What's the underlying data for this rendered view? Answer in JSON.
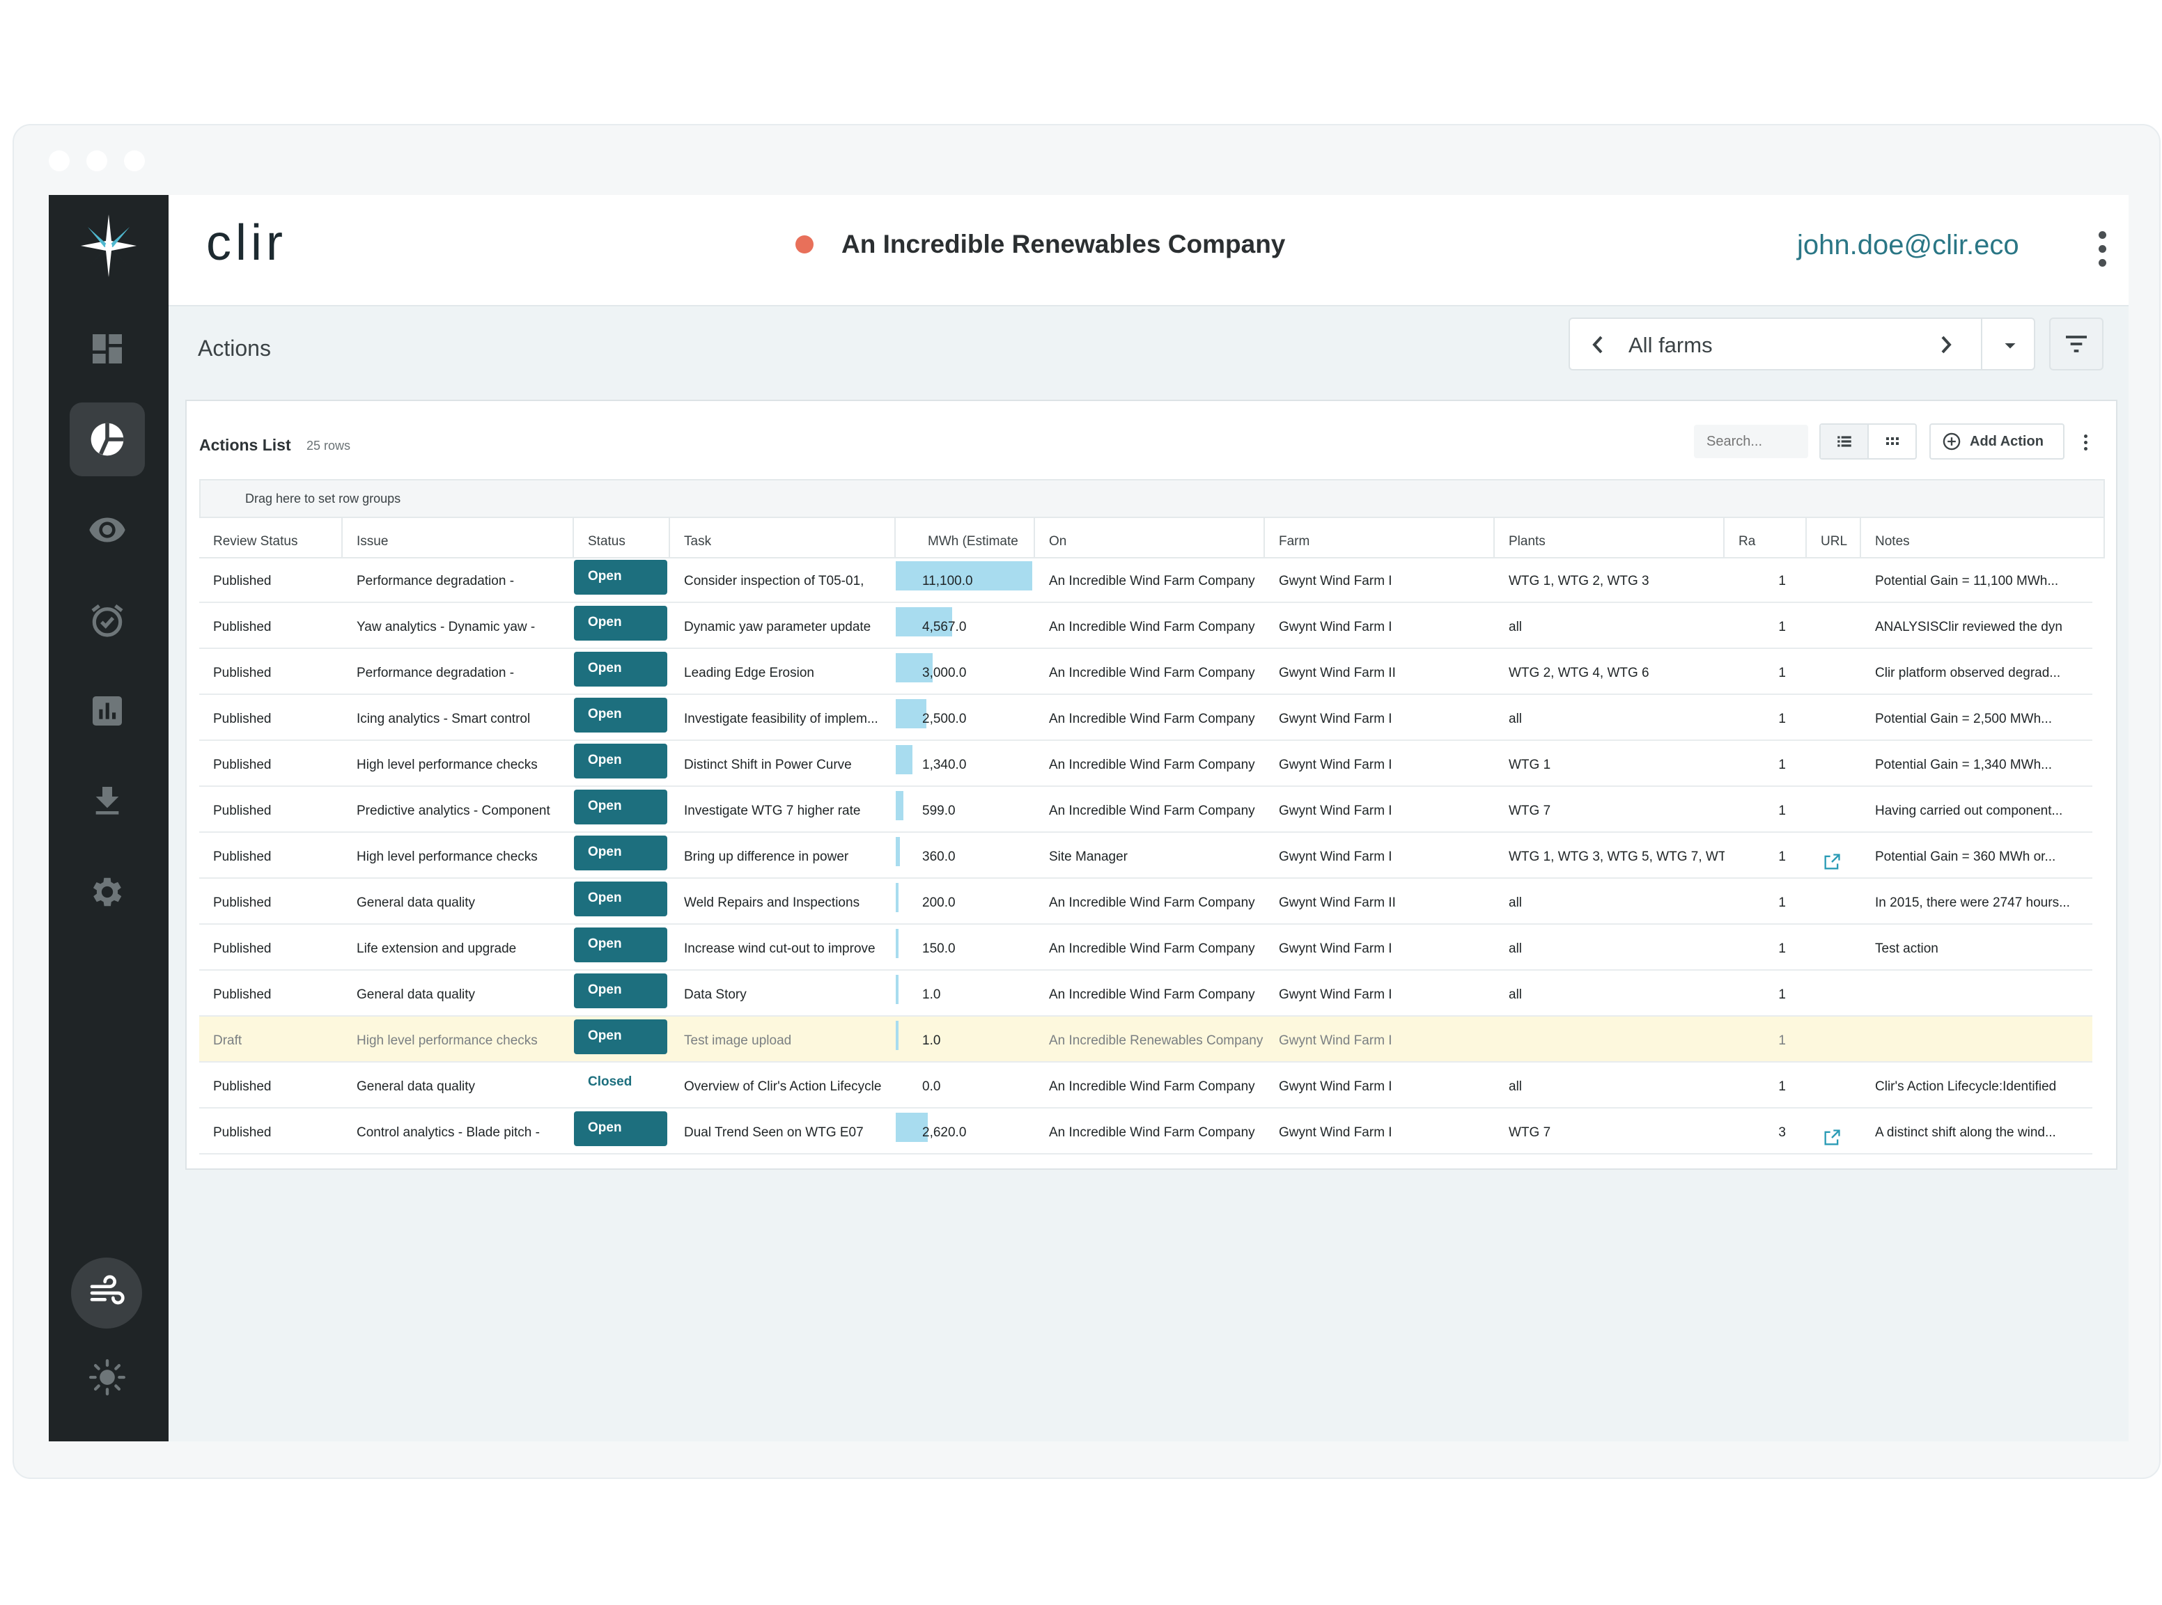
{
  "header": {
    "logo": "clir",
    "company": "An Incredible Renewables Company",
    "user_email": "john.doe@clir.eco"
  },
  "colors": {
    "accent": "#1d6f7e",
    "status_dot": "#e8705a",
    "sidebar": "#1f2426",
    "bar": "#a8dcef",
    "draft_row": "#fdf8dd"
  },
  "sidebar": {
    "items": [
      {
        "icon": "dashboard-icon"
      },
      {
        "icon": "pie-chart-icon",
        "active": true
      },
      {
        "icon": "eye-icon"
      },
      {
        "icon": "alarm-clock-icon"
      },
      {
        "icon": "bar-chart-icon"
      },
      {
        "icon": "download-icon"
      },
      {
        "icon": "gear-icon"
      }
    ],
    "bottom": [
      {
        "icon": "wind-icon"
      },
      {
        "icon": "sun-icon"
      }
    ]
  },
  "page": {
    "title": "Actions",
    "farm_selector": "All farms"
  },
  "card": {
    "title": "Actions List",
    "row_count": "25 rows",
    "search_placeholder": "Search...",
    "add_action": "Add Action",
    "group_zone": "Drag here to set row groups"
  },
  "table": {
    "columns": [
      "Review Status",
      "Issue",
      "Status",
      "Task",
      "MWh (Estimate",
      "On",
      "Farm",
      "Plants",
      "Ra",
      "URL",
      "Notes"
    ],
    "rows": [
      {
        "review": "Published",
        "issue": "Performance degradation -",
        "status": "Open",
        "task": "Consider inspection of T05-01,",
        "mwh": "11,100.0",
        "mwh_value": 11100,
        "on": "An Incredible Wind Farm Company",
        "farm": "Gwynt Wind Farm I",
        "plants": "WTG 1, WTG 2, WTG 3",
        "ra": "1",
        "url": false,
        "notes": "Potential Gain = 11,100 MWh..."
      },
      {
        "review": "Published",
        "issue": "Yaw analytics - Dynamic yaw -",
        "status": "Open",
        "task": "Dynamic yaw parameter update",
        "mwh": "4,567.0",
        "mwh_value": 4567,
        "on": "An Incredible Wind Farm Company",
        "farm": "Gwynt Wind Farm I",
        "plants": "all",
        "ra": "1",
        "url": false,
        "notes": "ANALYSISClir reviewed the dyn"
      },
      {
        "review": "Published",
        "issue": "Performance degradation -",
        "status": "Open",
        "task": "Leading Edge Erosion",
        "mwh": "3,000.0",
        "mwh_value": 3000,
        "on": "An Incredible Wind Farm Company",
        "farm": "Gwynt Wind Farm II",
        "plants": "WTG 2, WTG 4, WTG 6",
        "ra": "1",
        "url": false,
        "notes": "Clir platform observed degrad..."
      },
      {
        "review": "Published",
        "issue": "Icing analytics - Smart control",
        "status": "Open",
        "task": "Investigate feasibility of implem...",
        "mwh": "2,500.0",
        "mwh_value": 2500,
        "on": "An Incredible Wind Farm Company",
        "farm": "Gwynt Wind Farm I",
        "plants": "all",
        "ra": "1",
        "url": false,
        "notes": "Potential Gain = 2,500 MWh..."
      },
      {
        "review": "Published",
        "issue": "High level performance checks",
        "status": "Open",
        "task": "Distinct Shift in Power Curve",
        "mwh": "1,340.0",
        "mwh_value": 1340,
        "on": "An Incredible Wind Farm Company",
        "farm": "Gwynt Wind Farm I",
        "plants": "WTG 1",
        "ra": "1",
        "url": false,
        "notes": "Potential Gain = 1,340 MWh..."
      },
      {
        "review": "Published",
        "issue": "Predictive analytics - Component",
        "status": "Open",
        "task": "Investigate WTG 7 higher rate",
        "mwh": "599.0",
        "mwh_value": 599,
        "on": "An Incredible Wind Farm Company",
        "farm": "Gwynt Wind Farm I",
        "plants": "WTG 7",
        "ra": "1",
        "url": false,
        "notes": "Having carried out component..."
      },
      {
        "review": "Published",
        "issue": "High level performance checks",
        "status": "Open",
        "task": "Bring up difference in power",
        "mwh": "360.0",
        "mwh_value": 360,
        "on": "Site Manager",
        "farm": "Gwynt Wind Farm I",
        "plants": "WTG 1, WTG 3, WTG 5, WTG 7, WTG",
        "ra": "1",
        "url": true,
        "notes": "Potential Gain = 360 MWh or..."
      },
      {
        "review": "Published",
        "issue": "General data quality",
        "status": "Open",
        "task": "Weld Repairs and Inspections",
        "mwh": "200.0",
        "mwh_value": 200,
        "on": "An Incredible Wind Farm Company",
        "farm": "Gwynt Wind Farm II",
        "plants": "all",
        "ra": "1",
        "url": false,
        "notes": "In 2015, there were 2747 hours..."
      },
      {
        "review": "Published",
        "issue": "Life extension and upgrade",
        "status": "Open",
        "task": "Increase wind cut-out to improve",
        "mwh": "150.0",
        "mwh_value": 150,
        "on": "An Incredible Wind Farm Company",
        "farm": "Gwynt Wind Farm I",
        "plants": "all",
        "ra": "1",
        "url": false,
        "notes": "Test action"
      },
      {
        "review": "Published",
        "issue": "General data quality",
        "status": "Open",
        "task": "Data Story",
        "mwh": "1.0",
        "mwh_value": 1,
        "on": "An Incredible Wind Farm Company",
        "farm": "Gwynt Wind Farm I",
        "plants": "all",
        "ra": "1",
        "url": false,
        "notes": ""
      },
      {
        "review": "Draft",
        "issue": "High level performance checks",
        "status": "Open",
        "task": "Test image upload",
        "mwh": "1.0",
        "mwh_value": 1,
        "on": "An Incredible Renewables Company",
        "farm": "Gwynt Wind Farm I",
        "plants": "",
        "ra": "1",
        "url": false,
        "notes": ""
      },
      {
        "review": "Published",
        "issue": "General data quality",
        "status": "Closed",
        "task": "Overview of Clir's Action Lifecycle",
        "mwh": "0.0",
        "mwh_value": 0,
        "on": "An Incredible Wind Farm Company",
        "farm": "Gwynt Wind Farm I",
        "plants": "all",
        "ra": "1",
        "url": false,
        "notes": "Clir's Action Lifecycle:Identified"
      },
      {
        "review": "Published",
        "issue": "Control analytics - Blade pitch -",
        "status": "Open",
        "task": "Dual Trend Seen on WTG E07",
        "mwh": "2,620.0",
        "mwh_value": 2620,
        "on": "An Incredible Wind Farm Company",
        "farm": "Gwynt Wind Farm I",
        "plants": "WTG 7",
        "ra": "3",
        "url": true,
        "notes": "A distinct shift along the wind..."
      }
    ]
  }
}
